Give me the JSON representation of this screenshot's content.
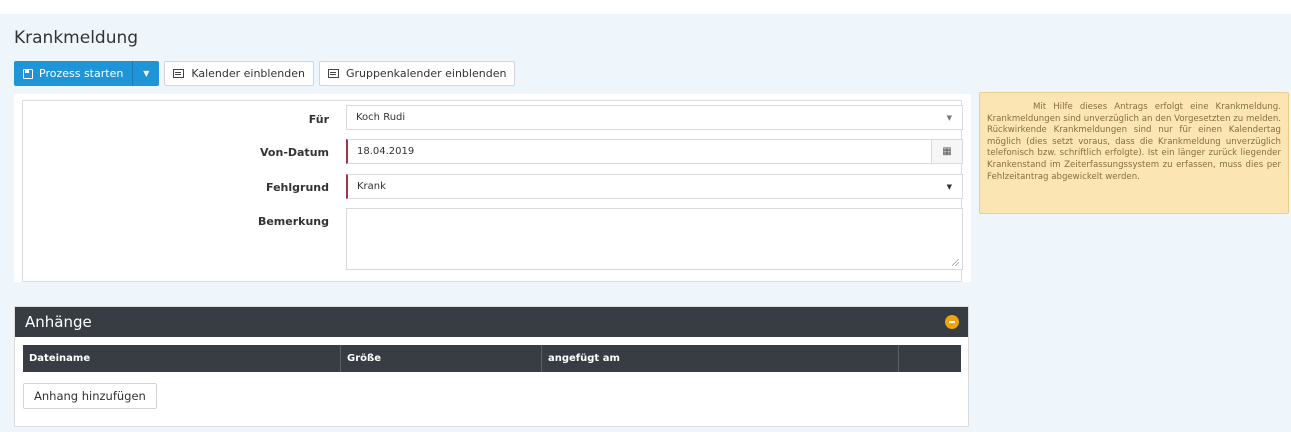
{
  "page": {
    "title": "Krankmeldung"
  },
  "toolbar": {
    "start_label": "Prozess starten",
    "calendar_label": "Kalender einblenden",
    "group_calendar_label": "Gruppenkalender einblenden"
  },
  "form": {
    "fuer": {
      "label": "Für",
      "value": "Koch Rudi"
    },
    "von_datum": {
      "label": "Von-Datum",
      "value": "18.04.2019"
    },
    "fehlgrund": {
      "label": "Fehlgrund",
      "value": "Krank"
    },
    "bemerkung": {
      "label": "Bemerkung",
      "value": ""
    }
  },
  "info": {
    "text": "Mit Hilfe dieses Antrags erfolgt eine Krankmeldung. Krankmeldungen sind unverzüglich an den Vorgesetzten zu melden. Rückwirkende Krankmeldungen sind nur für einen Kalendertag möglich (dies setzt voraus, dass die Krankmeldung unverzüglich telefonisch bzw. schriftlich erfolgte). Ist ein länger zurück liegender Krankenstand im Zeiterfassungssystem zu erfassen, muss dies per Fehlzeitantrag abgewickelt werden."
  },
  "attachments": {
    "title": "Anhänge",
    "columns": [
      "Dateiname",
      "Größe",
      "angefügt am",
      ""
    ],
    "add_label": "Anhang hinzufügen"
  },
  "colors": {
    "primary": "#1f94d8",
    "panel_dark": "#373d43",
    "required_marker": "#a0344a",
    "info_bg": "#fbe6b3",
    "info_text": "#8a6d3b",
    "collapse_icon": "#f0a30a"
  },
  "icons": [
    "floppy-icon",
    "caret-down-icon",
    "calendar-list-icon",
    "select-arrow-icon",
    "calendar-icon",
    "collapse-minus-icon",
    "resize-grip-icon"
  ]
}
